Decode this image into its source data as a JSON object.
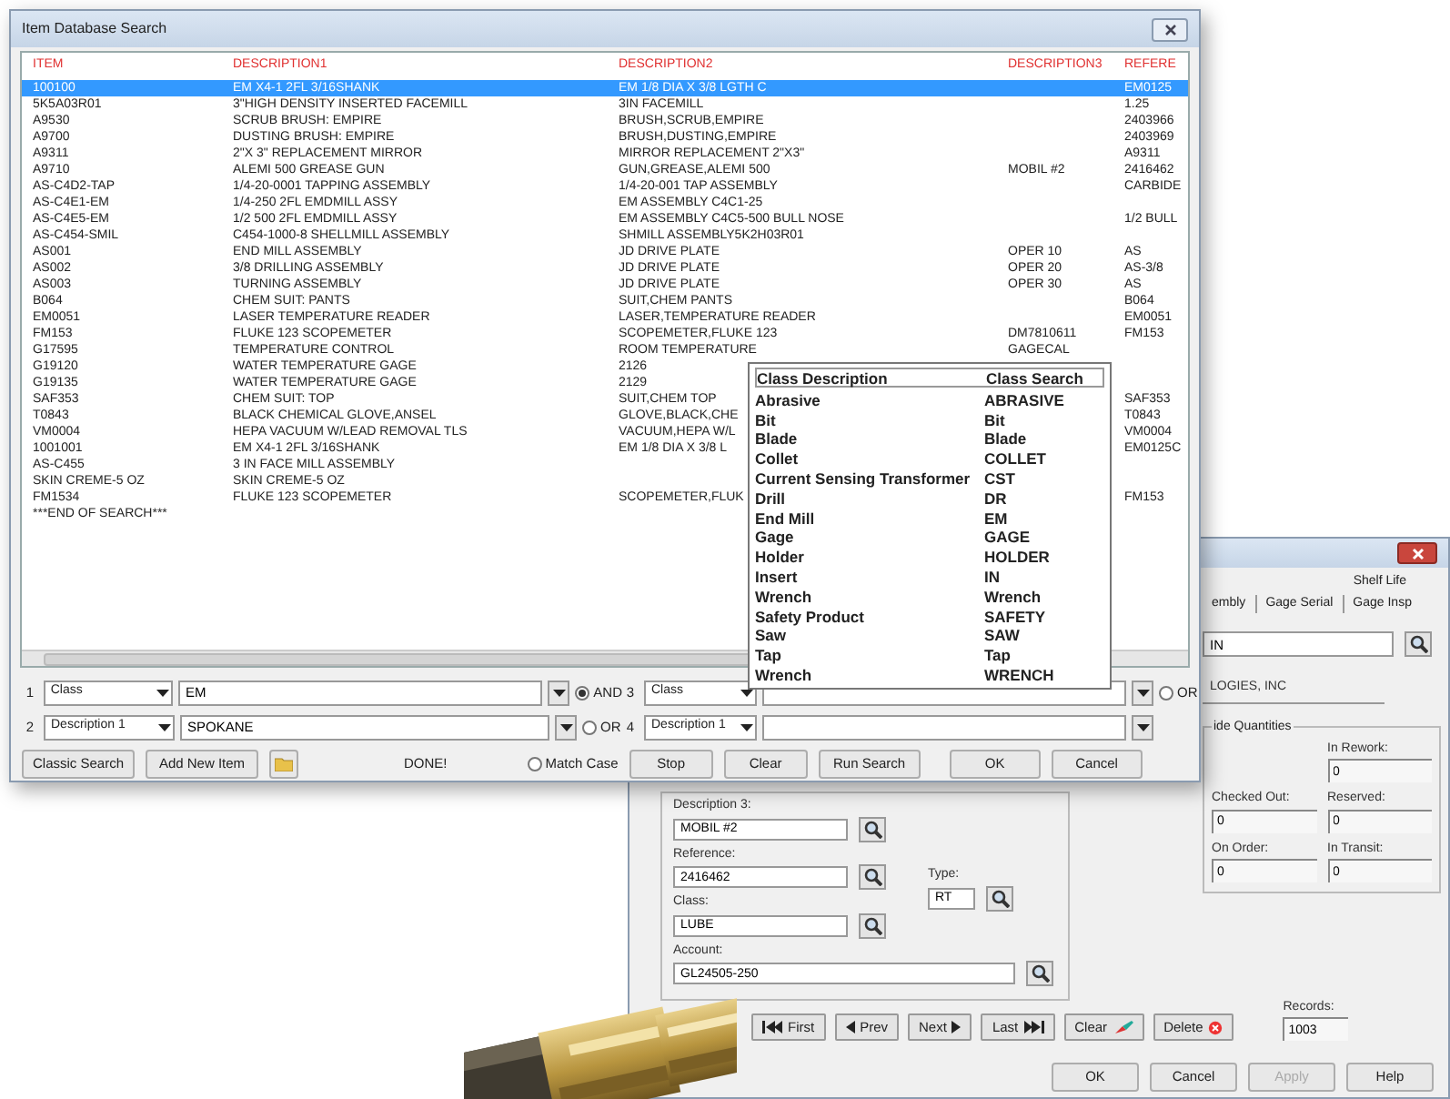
{
  "search_window": {
    "title": "Item Database Search",
    "columns": [
      "ITEM",
      "DESCRIPTION1",
      "DESCRIPTION2",
      "DESCRIPTION3",
      "REFERE"
    ],
    "rows": [
      {
        "cells": [
          "100100",
          "EM X4-1 2FL 3/16SHANK",
          "EM 1/8 DIA X 3/8 LGTH C",
          "",
          "EM0125"
        ],
        "selected": true
      },
      {
        "cells": [
          "5K5A03R01",
          "3\"HIGH DENSITY INSERTED FACEMILL",
          "3IN FACEMILL",
          "",
          "1.25"
        ],
        "selected": false
      },
      {
        "cells": [
          "A9530",
          "SCRUB BRUSH: EMPIRE",
          "BRUSH,SCRUB,EMPIRE",
          "",
          "2403966"
        ],
        "selected": false
      },
      {
        "cells": [
          "A9700",
          "DUSTING BRUSH: EMPIRE",
          "BRUSH,DUSTING,EMPIRE",
          "",
          "2403969"
        ],
        "selected": false
      },
      {
        "cells": [
          "A9311",
          "2\"X 3\" REPLACEMENT MIRROR",
          "MIRROR REPLACEMENT 2\"X3\"",
          "",
          "A9311"
        ],
        "selected": false
      },
      {
        "cells": [
          "A9710",
          "ALEMI 500 GREASE GUN",
          "GUN,GREASE,ALEMI 500",
          "MOBIL #2",
          "2416462"
        ],
        "selected": false
      },
      {
        "cells": [
          "AS-C4D2-TAP",
          "1/4-20-0001 TAPPING ASSEMBLY",
          "1/4-20-001 TAP ASSEMBLY",
          "",
          "CARBIDE"
        ],
        "selected": false
      },
      {
        "cells": [
          "AS-C4E1-EM",
          "1/4-250 2FL EMDMILL ASSY",
          "EM ASSEMBLY C4C1-25",
          "",
          ""
        ],
        "selected": false
      },
      {
        "cells": [
          "AS-C4E5-EM",
          "1/2 500 2FL EMDMILL ASSY",
          "EM ASSEMBLY C4C5-500 BULL NOSE",
          "",
          "1/2 BULL"
        ],
        "selected": false
      },
      {
        "cells": [
          "AS-C454-SMIL",
          "C454-1000-8 SHELLMILL ASSEMBLY",
          "SHMILL ASSEMBLY5K2H03R01",
          "",
          ""
        ],
        "selected": false
      },
      {
        "cells": [
          "AS001",
          "END MILL ASSEMBLY",
          "JD DRIVE PLATE",
          "OPER 10",
          "AS"
        ],
        "selected": false
      },
      {
        "cells": [
          "AS002",
          "3/8 DRILLING ASSEMBLY",
          "JD DRIVE PLATE",
          "OPER 20",
          "AS-3/8"
        ],
        "selected": false
      },
      {
        "cells": [
          "AS003",
          "TURNING ASSEMBLY",
          "JD DRIVE PLATE",
          "OPER 30",
          "AS"
        ],
        "selected": false
      },
      {
        "cells": [
          "B064",
          "CHEM SUIT: PANTS",
          "SUIT,CHEM PANTS",
          "",
          "B064"
        ],
        "selected": false
      },
      {
        "cells": [
          "EM0051",
          "LASER TEMPERATURE READER",
          "LASER,TEMPERATURE READER",
          "",
          "EM0051"
        ],
        "selected": false
      },
      {
        "cells": [
          "FM153",
          "FLUKE 123 SCOPEMETER",
          "SCOPEMETER,FLUKE 123",
          "DM7810611",
          "FM153"
        ],
        "selected": false
      },
      {
        "cells": [
          "G17595",
          "TEMPERATURE CONTROL",
          "ROOM TEMPERATURE",
          "GAGECAL",
          ""
        ],
        "selected": false
      },
      {
        "cells": [
          "G19120",
          "WATER TEMPERATURE GAGE",
          "2126",
          "",
          ""
        ],
        "selected": false
      },
      {
        "cells": [
          "G19135",
          "WATER TEMPERATURE GAGE",
          "2129",
          "",
          ""
        ],
        "selected": false
      },
      {
        "cells": [
          "SAF353",
          "CHEM SUIT: TOP",
          "SUIT,CHEM TOP",
          "",
          "SAF353"
        ],
        "selected": false
      },
      {
        "cells": [
          "T0843",
          "BLACK CHEMICAL GLOVE,ANSEL",
          "GLOVE,BLACK,CHE",
          "",
          "T0843"
        ],
        "selected": false
      },
      {
        "cells": [
          "VM0004",
          "HEPA VACUUM W/LEAD REMOVAL TLS",
          "VACUUM,HEPA W/L",
          "",
          "VM0004"
        ],
        "selected": false
      },
      {
        "cells": [
          "1001001",
          "EM X4-1 2FL 3/16SHANK",
          "EM 1/8 DIA X 3/8 L",
          "",
          "EM0125C"
        ],
        "selected": false
      },
      {
        "cells": [
          "AS-C455",
          "3 IN FACE MILL ASSEMBLY",
          "",
          "",
          ""
        ],
        "selected": false
      },
      {
        "cells": [
          "SKIN CREME-5 OZ",
          "SKIN CREME-5 OZ",
          "",
          "",
          ""
        ],
        "selected": false
      },
      {
        "cells": [
          "FM1534",
          "FLUKE 123 SCOPEMETER",
          "SCOPEMETER,FLUK",
          "",
          "FM153"
        ],
        "selected": false
      },
      {
        "cells": [
          "***END OF SEARCH***",
          "",
          "",
          "",
          ""
        ],
        "selected": false
      }
    ],
    "class_popup": {
      "headers": [
        "Class Description",
        "Class Search"
      ],
      "rows": [
        [
          "Abrasive",
          "ABRASIVE"
        ],
        [
          "Bit",
          "Bit"
        ],
        [
          "Blade",
          "Blade"
        ],
        [
          "Collet",
          "COLLET"
        ],
        [
          "Current Sensing Transformer",
          "CST"
        ],
        [
          "Drill",
          "DR"
        ],
        [
          "End Mill",
          "EM"
        ],
        [
          "Gage",
          "GAGE"
        ],
        [
          "Holder",
          "HOLDER"
        ],
        [
          "Insert",
          "IN"
        ],
        [
          "Wrench",
          "Wrench"
        ],
        [
          "Safety Product",
          "SAFETY"
        ],
        [
          "Saw",
          "SAW"
        ],
        [
          "Tap",
          "Tap"
        ],
        [
          "Wrench",
          "WRENCH"
        ]
      ]
    },
    "criteria": [
      {
        "number": "1",
        "field": "Class",
        "value": "EM",
        "option": {
          "label": "AND",
          "selected": true
        }
      },
      {
        "number": "2",
        "field": "Description 1",
        "value": "SPOKANE",
        "option": {
          "label": "OR",
          "selected": false
        }
      },
      {
        "number": "3",
        "field": "Class",
        "option": {
          "label": "OR",
          "selected": false
        }
      },
      {
        "number": "4",
        "field": "Description 1"
      }
    ],
    "left_buttons": [
      "Classic Search",
      "Add New Item"
    ],
    "status": "DONE!",
    "match_case": {
      "label": "Match Case",
      "checked": false
    },
    "right_buttons": [
      "Stop",
      "Clear",
      "Run Search",
      "OK",
      "Cancel"
    ]
  },
  "item_window": {
    "tabs": [
      [
        "Shelf Life"
      ],
      [
        "embly",
        "Gage Serial",
        "Gage Insp"
      ]
    ],
    "lookup_value": "IN",
    "company": "LOGIES, INC",
    "quantities": {
      "title": "ide Quantities",
      "fields": [
        {
          "label": "In Rework:",
          "value": "0"
        },
        {
          "label": "Checked Out:",
          "value": "0"
        },
        {
          "label": "Reserved:",
          "value": "0"
        },
        {
          "label": "On Order:",
          "value": "0"
        },
        {
          "label": "In Transit:",
          "value": "0"
        }
      ]
    },
    "fields": [
      {
        "label": "Description 3:",
        "value": "MOBIL #2"
      },
      {
        "label": "Reference:",
        "value": "2416462"
      },
      {
        "label": "Class:",
        "value": "LUBE"
      }
    ],
    "type": {
      "label": "Type:",
      "value": "RT"
    },
    "account": {
      "label": "Account:",
      "value": "GL24505-250"
    },
    "nav_buttons": [
      {
        "label": "First",
        "kind": "first"
      },
      {
        "label": "Prev",
        "kind": "prev"
      },
      {
        "label": "Next",
        "kind": "next"
      },
      {
        "label": "Last",
        "kind": "last"
      },
      {
        "label": "Clear",
        "kind": "clear"
      },
      {
        "label": "Delete",
        "kind": "delete"
      }
    ],
    "records": {
      "label": "Records:",
      "value": "1003"
    },
    "dialog_buttons": [
      {
        "label": "OK",
        "disabled": false
      },
      {
        "label": "Cancel",
        "disabled": false
      },
      {
        "label": "Apply",
        "disabled": true
      },
      {
        "label": "Help",
        "disabled": false
      }
    ]
  }
}
